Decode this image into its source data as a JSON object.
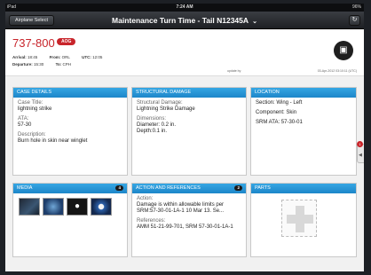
{
  "status_bar": {
    "carrier": "iPad",
    "time": "7:24 AM",
    "battery": "96%"
  },
  "nav": {
    "airplane_select": "Airplane Select",
    "title": "Maintenance Turn Time - Tail N12345A",
    "title_chevron": "⌄",
    "refresh_icon": "refresh-icon"
  },
  "header": {
    "tail": "737-800",
    "badge": "AOG",
    "arrival_label": "Arrival:",
    "arrival": "18:45",
    "from_label": "From:",
    "from": "ORL",
    "utc_label": "UTC:",
    "utc": "12:05",
    "departure_label": "Departure:",
    "departure": "15:30",
    "to_label": "To:",
    "to": "CPH",
    "updated_by": "update by",
    "updated_at": "03-Apr-2012 03:10:11 (UTC)"
  },
  "case_details": {
    "heading": "Case Details",
    "case_title_label": "Case Title:",
    "case_title": "lightning strike",
    "ata_label": "ATA:",
    "ata": "57-30",
    "description_label": "Description:",
    "description": "Burn hole in skin near winglet"
  },
  "structural_damage": {
    "heading": "Structural Damage",
    "sd_label": "Structural Damage:",
    "sd": "Lightning Strike Damage",
    "dimensions_label": "Dimensions:",
    "diameter": "Diameter: 0.2 in.",
    "depth": "Depth:0.1 in."
  },
  "location": {
    "heading": "Location",
    "section": "Section: Wing - Left",
    "component": "Component: Skin",
    "srm_ata": "SRM ATA: 57-30-01"
  },
  "media": {
    "heading": "Media",
    "count": "4"
  },
  "action_refs": {
    "heading": "Action and References",
    "count": "2",
    "action_label": "Action:",
    "action": "Damage is within allowable limits per SRM:57-30-01-1A-1 10 Mar 13. Se...",
    "references_label": "References:",
    "references": "AMM 51-21-99-701, SRM 57-30-01-1A-1"
  },
  "parts": {
    "heading": "Parts"
  },
  "side_tab": {
    "notification": "1"
  }
}
